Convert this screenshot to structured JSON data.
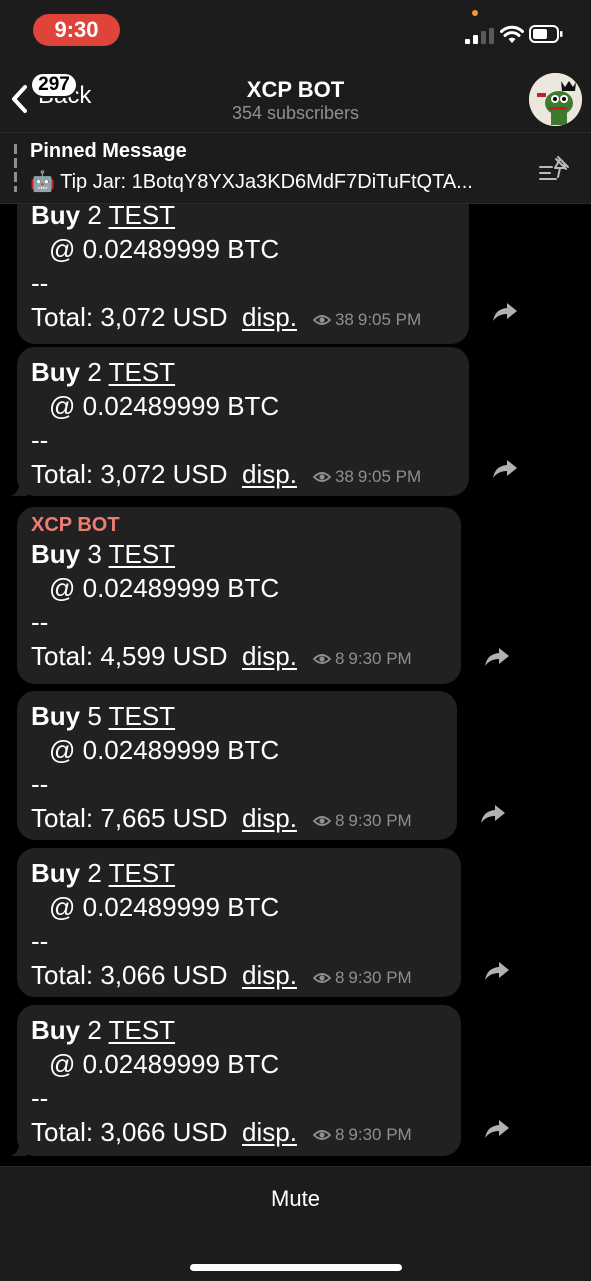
{
  "status_bar": {
    "time": "9:30"
  },
  "header": {
    "back_label": "Back",
    "back_badge": "297",
    "title": "XCP BOT",
    "subtitle": "354 subscribers"
  },
  "pinned": {
    "title": "Pinned Message",
    "text": "🤖 Tip Jar: 1BotqY8YXJa3KD6MdF7DiTuFtQTA..."
  },
  "messages": [
    {
      "sender": "",
      "action": "Buy",
      "qty": "2",
      "asset": "TEST",
      "price": "@ 0.02489999 BTC",
      "sep": "--",
      "total": "Total: 3,072 USD",
      "link": "disp.",
      "views": "38",
      "time": "9:05 PM"
    },
    {
      "sender": "",
      "action": "Buy",
      "qty": "2",
      "asset": "TEST",
      "price": "@ 0.02489999 BTC",
      "sep": "--",
      "total": "Total: 3,072 USD",
      "link": "disp.",
      "views": "38",
      "time": "9:05 PM"
    },
    {
      "sender": "XCP BOT",
      "action": "Buy",
      "qty": "3",
      "asset": "TEST",
      "price": "@ 0.02489999 BTC",
      "sep": "--",
      "total": "Total: 4,599 USD",
      "link": "disp.",
      "views": "8",
      "time": "9:30 PM"
    },
    {
      "sender": "",
      "action": "Buy",
      "qty": "5",
      "asset": "TEST",
      "price": "@ 0.02489999 BTC",
      "sep": "--",
      "total": "Total: 7,665 USD",
      "link": "disp.",
      "views": "8",
      "time": "9:30 PM"
    },
    {
      "sender": "",
      "action": "Buy",
      "qty": "2",
      "asset": "TEST",
      "price": "@ 0.02489999 BTC",
      "sep": "--",
      "total": "Total: 3,066 USD",
      "link": "disp.",
      "views": "8",
      "time": "9:30 PM"
    },
    {
      "sender": "",
      "action": "Buy",
      "qty": "2",
      "asset": "TEST",
      "price": "@ 0.02489999 BTC",
      "sep": "--",
      "total": "Total: 3,066 USD",
      "link": "disp.",
      "views": "8",
      "time": "9:30 PM"
    }
  ],
  "bottom": {
    "mute_label": "Mute"
  },
  "icons": {
    "back": "chevron-left-icon",
    "pin": "pinned-list-icon",
    "views": "eye-icon",
    "share": "share-arrow-icon",
    "signal": "cellular-signal-icon",
    "wifi": "wifi-icon",
    "battery": "battery-icon"
  },
  "colors": {
    "bubble": "#212122",
    "sender": "#ef7d72",
    "time_pill": "#e0433a",
    "bar": "#1c1c1d"
  }
}
